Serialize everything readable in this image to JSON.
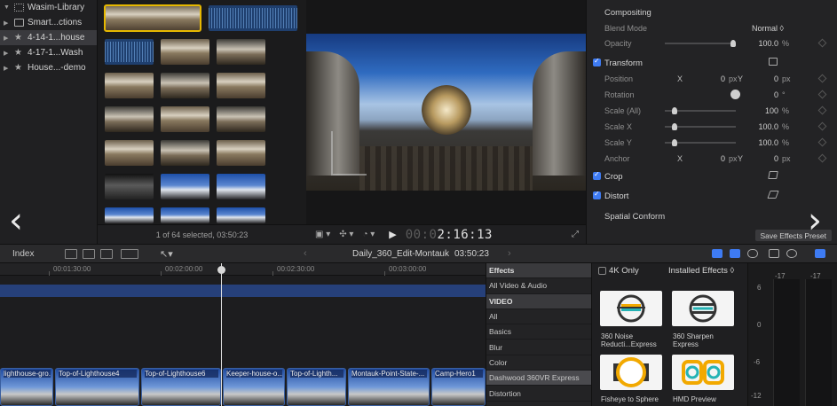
{
  "library": {
    "items": [
      {
        "label": "Wasim-Library",
        "kind": "library"
      },
      {
        "label": "Smart...ctions",
        "kind": "smart"
      },
      {
        "label": "4-14-1...house",
        "kind": "event",
        "selected": true
      },
      {
        "label": "4-17-1...Wash",
        "kind": "event"
      },
      {
        "label": "House...-demo",
        "kind": "event"
      }
    ]
  },
  "browser": {
    "status": "1 of 64 selected, 03:50:23"
  },
  "viewer": {
    "timecode_dim": "00:0",
    "timecode": "2:16:13"
  },
  "inspector": {
    "compositing": "Compositing",
    "blend_mode_label": "Blend Mode",
    "blend_mode_value": "Normal ◊",
    "opacity_label": "Opacity",
    "opacity_value": "100.0",
    "opacity_unit": "%",
    "transform": "Transform",
    "position_label": "Position",
    "position_x_label": "X",
    "position_x": "0",
    "position_y_label": "Y",
    "position_y": "0",
    "px": "px",
    "rotation_label": "Rotation",
    "rotation_value": "0",
    "rotation_unit": "°",
    "scale_all_label": "Scale (All)",
    "scale_all_value": "100",
    "scale_x_label": "Scale X",
    "scale_x_value": "100.0",
    "scale_y_label": "Scale Y",
    "scale_y_value": "100.0",
    "anchor_label": "Anchor",
    "anchor_x_label": "X",
    "anchor_x": "0",
    "anchor_y_label": "Y",
    "anchor_y": "0",
    "crop": "Crop",
    "distort": "Distort",
    "spatial_conform": "Spatial Conform",
    "save_preset": "Save Effects Preset"
  },
  "toolbar": {
    "index": "Index",
    "project_name": "Daily_360_Edit-Montauk",
    "duration": "03:50:23"
  },
  "timeline": {
    "ruler": [
      "00:01:30:00",
      "00:02:00:00",
      "00:02:30:00",
      "00:03:00:00"
    ],
    "clips": [
      "lighthouse-gro...",
      "Top-of-Lighthouse4",
      "Top-of-Lighthouse6",
      "Keeper-house-o...",
      "Top-of-Lighth...",
      "Montauk-Point-State-...",
      "Camp-Hero1"
    ]
  },
  "effects": {
    "categories": [
      {
        "label": "Effects",
        "header": true
      },
      {
        "label": "All Video & Audio"
      },
      {
        "label": "VIDEO",
        "header": true
      },
      {
        "label": "All"
      },
      {
        "label": "Basics"
      },
      {
        "label": "Blur"
      },
      {
        "label": "Color"
      },
      {
        "label": "Dashwood 360VR Express",
        "selected": true
      },
      {
        "label": "Distortion"
      }
    ],
    "four_k_only": "4K Only",
    "installed": "Installed Effects ◊",
    "tiles": [
      {
        "name": "360 Noise Reducti...Express",
        "icon": "noise-reduction-icon"
      },
      {
        "name": "360 Sharpen Express",
        "icon": "sharpen-icon"
      },
      {
        "name": "Fisheye to Sphere",
        "icon": "fisheye-icon"
      },
      {
        "name": "HMD Preview",
        "icon": "hmd-preview-icon"
      }
    ]
  },
  "meters": {
    "left_peak": "-17",
    "right_peak": "-17",
    "scale": [
      "6",
      "0",
      "-6",
      "-12"
    ]
  },
  "colors": {
    "accent_blue": "#3e7bf3",
    "selection_yellow": "#e6b800",
    "fx_orange": "#f2a900",
    "fx_teal": "#25b3b5"
  }
}
